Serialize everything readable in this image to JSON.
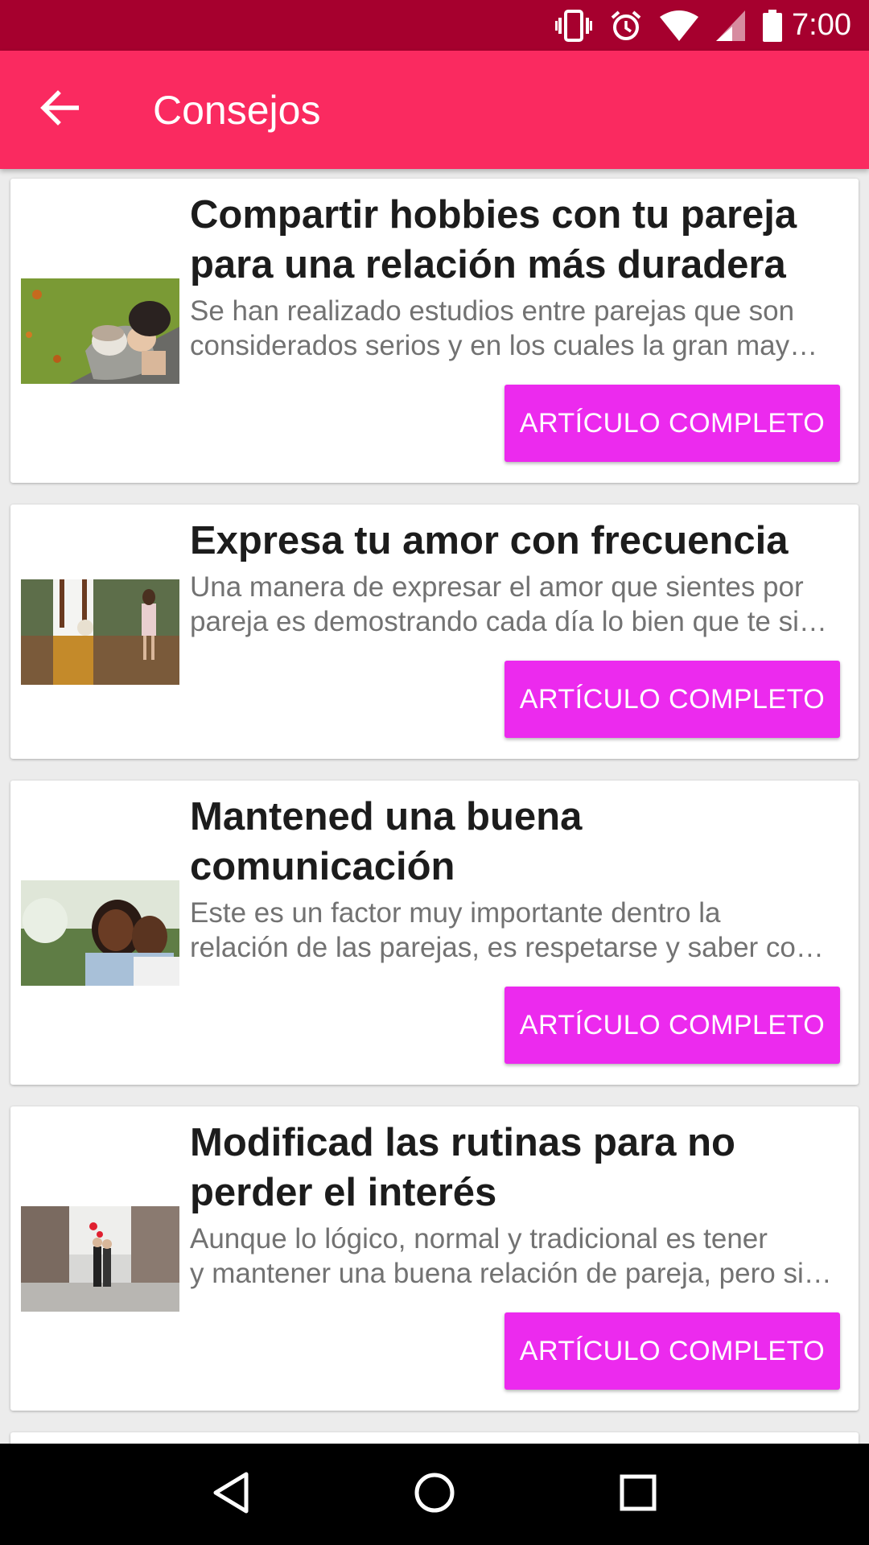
{
  "status_bar": {
    "time": "7:00",
    "icons": [
      "vibrate-icon",
      "alarm-icon",
      "wifi-icon",
      "cell-signal-icon",
      "battery-icon"
    ]
  },
  "app_bar": {
    "title": "Consejos",
    "back_icon": "arrow-back-icon"
  },
  "articles": [
    {
      "title": "Compartir hobbies con tu pareja para una relación más duradera",
      "desc_line1": "Se han realizado estudios entre parejas que son",
      "desc_line2": "considerados serios y en los cuales la gran may…",
      "button": "ARTÍCULO COMPLETO"
    },
    {
      "title": "Expresa tu amor con frecuencia",
      "desc_line1": "Una manera de expresar el amor que sientes por",
      "desc_line2": "pareja es demostrando cada día lo bien que te si…",
      "button": "ARTÍCULO COMPLETO"
    },
    {
      "title": "Mantened una buena comunicación",
      "desc_line1": "Este es un factor muy importante dentro la",
      "desc_line2": "relación de las parejas, es respetarse y saber co…",
      "button": "ARTÍCULO COMPLETO"
    },
    {
      "title": "Modificad las rutinas para no perder el interés",
      "desc_line1": "Aunque lo lógico, normal y tradicional es tener",
      "desc_line2": "y mantener una buena relación de pareja, pero si…",
      "button": "ARTÍCULO COMPLETO"
    }
  ],
  "nav_bar": {
    "icons": [
      "back-triangle-icon",
      "home-circle-icon",
      "recents-square-icon"
    ]
  },
  "colors": {
    "status_bar": "#a6002e",
    "app_bar": "#fa2a60",
    "button": "#ec2aee"
  }
}
